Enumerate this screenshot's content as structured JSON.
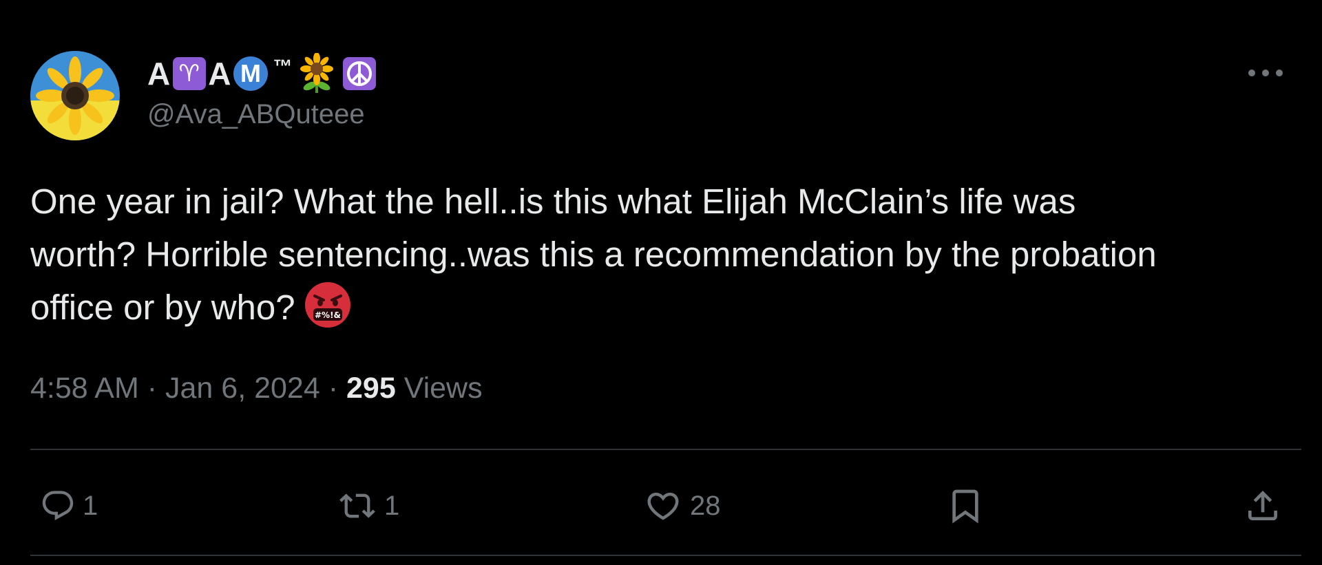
{
  "tweet": {
    "display_name_parts": [
      "A",
      "♈",
      "A",
      "M",
      "™"
    ],
    "display_name_emoji": [
      "sunflower",
      "peace-symbol"
    ],
    "handle": "@Ava_ABQuteee",
    "text": "One year in jail? What the hell..is this what Elijah McClain’s life was\nworth? Horrible sentencing..was this a recommendation by the probation\noffice or by who?",
    "text_emoji": "face-with-symbols-on-mouth",
    "time": "4:58 AM",
    "date": "Jan 6, 2024",
    "separator": "·",
    "views_count": "295",
    "views_label": "Views"
  },
  "actions": {
    "reply_count": "1",
    "repost_count": "1",
    "like_count": "28"
  },
  "icons": {
    "more": "more-horizontal-icon",
    "reply": "reply-icon",
    "repost": "repost-icon",
    "like": "heart-icon",
    "bookmark": "bookmark-icon",
    "share": "share-icon"
  },
  "colors": {
    "background": "#000000",
    "primary_text": "#e7e9ea",
    "secondary_text": "#71767b",
    "divider": "#2f3336",
    "aries_badge": "#8e5bd6",
    "m_badge": "#3b82d6"
  }
}
